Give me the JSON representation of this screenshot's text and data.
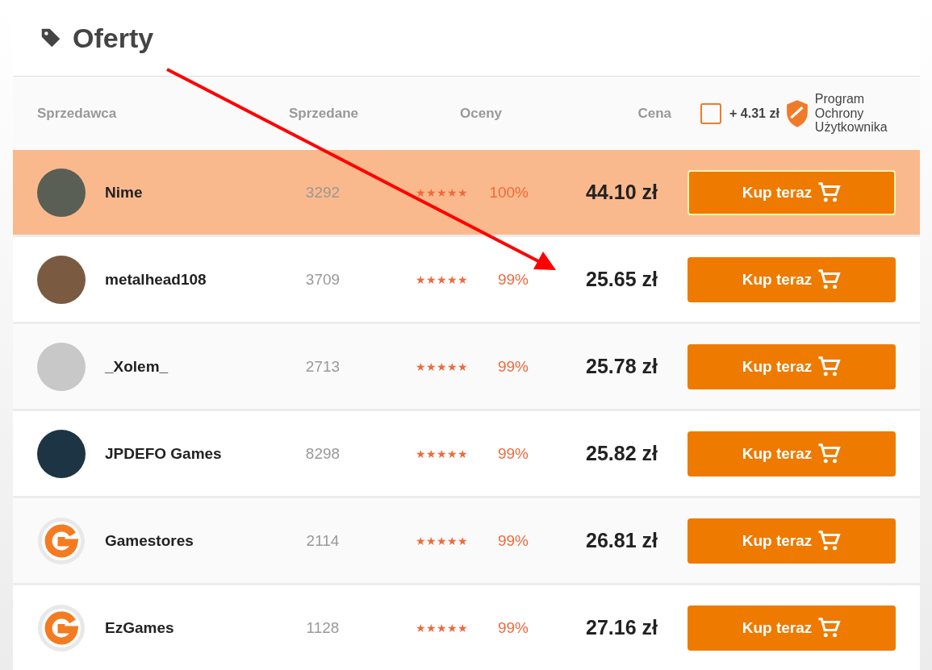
{
  "title": "Oferty",
  "columns": {
    "seller": "Sprzedawca",
    "sold": "Sprzedane",
    "ratings": "Oceny",
    "price": "Cena"
  },
  "protection": {
    "checked": false,
    "fee": "+ 4.31 zł",
    "label": "Program Ochrony Użytkownika"
  },
  "offers": [
    {
      "kind": "photo",
      "name": "Nime",
      "sold": "3292",
      "stars": 5,
      "percent": "100%",
      "price": "44.10 zł",
      "button": "Kup teraz",
      "selected": true
    },
    {
      "kind": "photo",
      "name": "metalhead108",
      "sold": "3709",
      "stars": 5,
      "percent": "99%",
      "price": "25.65 zł",
      "button": "Kup teraz",
      "selected": false
    },
    {
      "kind": "photo",
      "name": "_Xolem_",
      "sold": "2713",
      "stars": 5,
      "percent": "99%",
      "price": "25.78 zł",
      "button": "Kup teraz",
      "selected": false
    },
    {
      "kind": "photo",
      "name": "JPDEFO Games",
      "sold": "8298",
      "stars": 5,
      "percent": "99%",
      "price": "25.82 zł",
      "button": "Kup teraz",
      "selected": false
    },
    {
      "kind": "logo",
      "name": "Gamestores",
      "sold": "2114",
      "stars": 5,
      "percent": "99%",
      "price": "26.81 zł",
      "button": "Kup teraz",
      "selected": false
    },
    {
      "kind": "logo",
      "name": "EzGames",
      "sold": "1128",
      "stars": 5,
      "percent": "99%",
      "price": "27.16 zł",
      "button": "Kup teraz",
      "selected": false
    }
  ]
}
